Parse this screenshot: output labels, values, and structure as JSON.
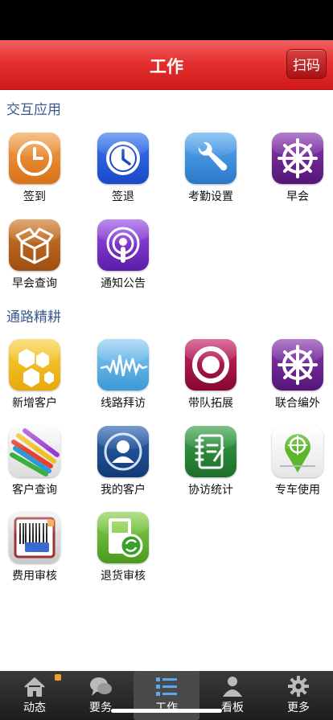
{
  "header": {
    "title": "工作",
    "scan_label": "扫码"
  },
  "sections": [
    {
      "title": "交互应用",
      "items": [
        {
          "label": "签到",
          "icon": "clock-icon",
          "color": "#e8882a"
        },
        {
          "label": "签退",
          "icon": "clock-icon",
          "color": "#1e5be0"
        },
        {
          "label": "考勤设置",
          "icon": "wrench-icon",
          "color": "#3b8fd8"
        },
        {
          "label": "早会",
          "icon": "wheel-icon",
          "color": "#6a1f8c"
        },
        {
          "label": "早会查询",
          "icon": "box-icon",
          "color": "#b8641e"
        },
        {
          "label": "通知公告",
          "icon": "podcast-icon",
          "color": "#7b2bd0"
        }
      ]
    },
    {
      "title": "通路精耕",
      "items": [
        {
          "label": "新增客户",
          "icon": "hexagon-icon",
          "color": "#f2c21a"
        },
        {
          "label": "线路拜访",
          "icon": "waveform-icon",
          "color": "#5fb4e8"
        },
        {
          "label": "带队拓展",
          "icon": "ring-icon",
          "color": "#a8124a"
        },
        {
          "label": "联合编外",
          "icon": "wheel-icon",
          "color": "#6a1f8c"
        },
        {
          "label": "客户查询",
          "icon": "pencils-icon",
          "color": "#f0f0f0"
        },
        {
          "label": "我的客户",
          "icon": "user-circle-icon",
          "color": "#1d4a8a"
        },
        {
          "label": "协访统计",
          "icon": "notebook-icon",
          "color": "#2e8a3a"
        },
        {
          "label": "专车使用",
          "icon": "map-pin-icon",
          "color": "#f4f4f4"
        },
        {
          "label": "费用审核",
          "icon": "barcode-icon",
          "color": "#e0e0e0"
        },
        {
          "label": "退货审核",
          "icon": "refund-icon",
          "color": "#6abd3a"
        }
      ]
    }
  ],
  "tabs": [
    {
      "label": "动态",
      "icon": "home-icon",
      "active": false
    },
    {
      "label": "要务",
      "icon": "chat-icon",
      "active": false
    },
    {
      "label": "工作",
      "icon": "list-icon",
      "active": true
    },
    {
      "label": "看板",
      "icon": "person-icon",
      "active": false
    },
    {
      "label": "更多",
      "icon": "gear-icon",
      "active": false
    }
  ]
}
